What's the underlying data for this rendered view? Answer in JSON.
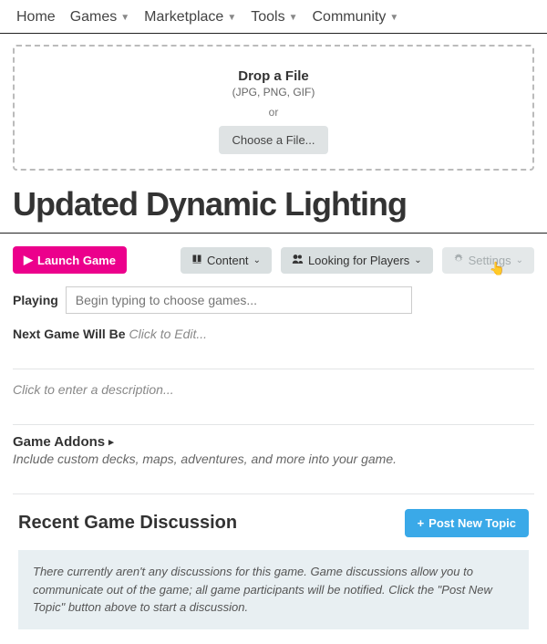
{
  "nav": {
    "items": [
      {
        "label": "Home",
        "has_dropdown": false
      },
      {
        "label": "Games",
        "has_dropdown": true
      },
      {
        "label": "Marketplace",
        "has_dropdown": true
      },
      {
        "label": "Tools",
        "has_dropdown": true
      },
      {
        "label": "Community",
        "has_dropdown": true
      }
    ]
  },
  "dropzone": {
    "title": "Drop a File",
    "subtitle": "(JPG, PNG, GIF)",
    "or": "or",
    "choose": "Choose a File..."
  },
  "page_title": "Updated Dynamic Lighting",
  "actions": {
    "launch": "Launch Game",
    "content": "Content",
    "looking": "Looking for Players",
    "settings": "Settings"
  },
  "playing": {
    "label": "Playing",
    "placeholder": "Begin typing to choose games..."
  },
  "next_game": {
    "label": "Next Game Will Be",
    "edit": "Click to Edit..."
  },
  "description_prompt": "Click to enter a description...",
  "addons": {
    "title": "Game Addons",
    "subtitle": "Include custom decks, maps, adventures, and more into your game."
  },
  "discussion": {
    "title": "Recent Game Discussion",
    "post_button": "Post New Topic",
    "empty": "There currently aren't any discussions for this game. Game discussions allow you to communicate out of the game; all game participants will be notified. Click the \"Post New Topic\" button above to start a discussion."
  }
}
